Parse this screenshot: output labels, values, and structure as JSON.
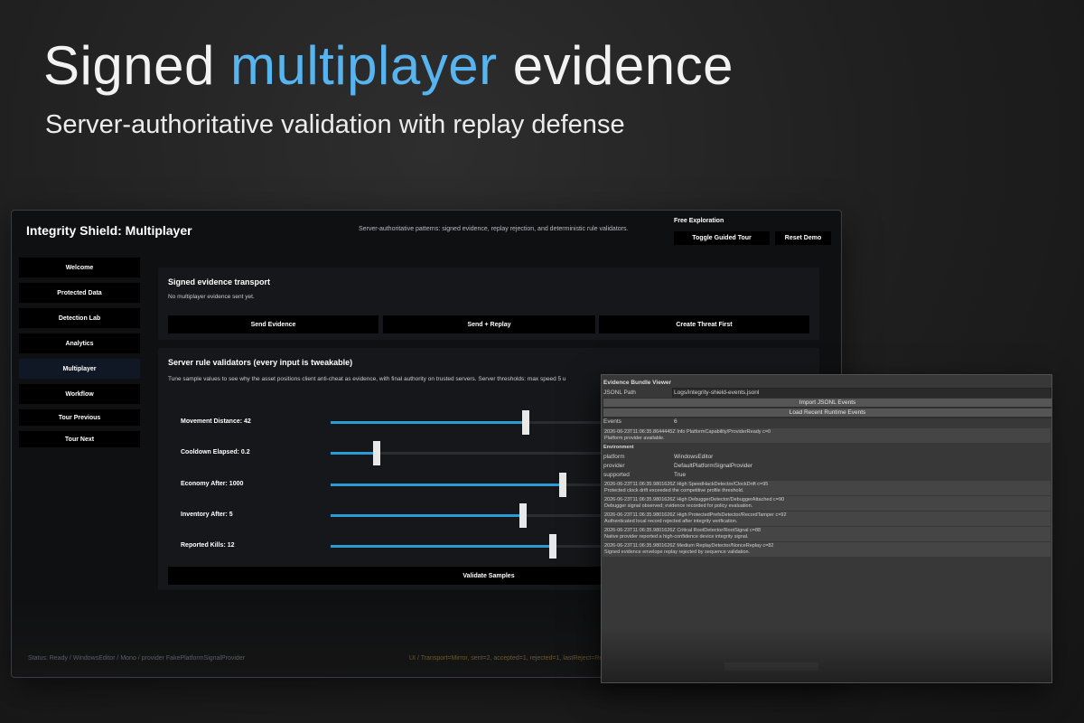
{
  "hero": {
    "title_pre": "Signed ",
    "title_accent": "multiplayer",
    "title_post": " evidence",
    "subtitle": "Server-authoritative validation with replay defense",
    "accent_color": "#58b4ee"
  },
  "app": {
    "title": "Integrity Shield: Multiplayer",
    "description": "Server-authoritative patterns: signed evidence, replay rejection, and deterministic rule validators.",
    "mode_label": "Free Exploration",
    "toggle_tour": "Toggle Guided Tour",
    "reset_demo": "Reset Demo",
    "nav": [
      {
        "label": "Welcome",
        "active": false
      },
      {
        "label": "Protected Data",
        "active": false
      },
      {
        "label": "Detection Lab",
        "active": false
      },
      {
        "label": "Analytics",
        "active": false
      },
      {
        "label": "Multiplayer",
        "active": true
      },
      {
        "label": "Workflow",
        "active": false
      },
      {
        "label": "Tour Previous",
        "active": false
      },
      {
        "label": "Tour Next",
        "active": false
      }
    ],
    "transport": {
      "title": "Signed evidence transport",
      "status": "No multiplayer evidence sent yet.",
      "buttons": [
        "Send Evidence",
        "Send + Replay",
        "Create Threat First"
      ]
    },
    "validators": {
      "title": "Server rule validators (every input is tweakable)",
      "description": "Tune sample values to see why the asset positions client anti-cheat as evidence, with final authority on trusted servers. Server thresholds: max speed 5 u",
      "sliders": [
        {
          "label": "Movement Distance: 42",
          "fraction": 0.4
        },
        {
          "label": "Cooldown Elapsed: 0.2",
          "fraction": 0.095
        },
        {
          "label": "Economy After: 1000",
          "fraction": 0.475
        },
        {
          "label": "Inventory After: 5",
          "fraction": 0.395
        },
        {
          "label": "Reported Kills: 12",
          "fraction": 0.455
        }
      ],
      "validate_button": "Validate Samples",
      "accent_color": "#2a9bd4"
    },
    "status_left": "Status: Ready / WindowsEditor / Mono / provider FakePlatformSignalProvider",
    "status_right": "UI / Transport=Mirror, sent=2, accepted=1, rejected=1, lastReject=Re"
  },
  "viewer": {
    "title": "Evidence Bundle Viewer",
    "jsonl_label": "JSONL Path",
    "jsonl_value": "Logs/integrity-shield-events.jsonl",
    "import_button": "Import JSONL Events",
    "load_button": "Load Recent Runtime Events",
    "events_label": "Events",
    "events_count": "6",
    "first_event": {
      "line1": "2026-06-23T11:06:35.8644445Z Info PlatformCapability/ProviderReady c=0",
      "line2": "Platform provider available."
    },
    "environment_label": "Environment",
    "environment": [
      {
        "key": "platform",
        "value": "WindowsEditor"
      },
      {
        "key": "provider",
        "value": "DefaultPlatformSignalProvider"
      },
      {
        "key": "supported",
        "value": "True"
      }
    ],
    "events": [
      {
        "line1": "2026-06-23T11:06:35.9801626Z High SpeedHackDetector/ClockDrift c=95",
        "line2": "Protected clock drift exceeded the competitive profile threshold."
      },
      {
        "line1": "2026-06-23T11:06:35.9801626Z High DebuggerDetector/DebuggerAttached c=90",
        "line2": "Debugger signal observed; evidence recorded for policy evaluation."
      },
      {
        "line1": "2026-06-23T11:06:35.9801626Z High ProtectedPrefsDetector/RecordTamper c=92",
        "line2": "Authenticated local record rejected after integrity verification."
      },
      {
        "line1": "2026-06-23T11:06:35.9801626Z Critical RootDetector/RootSignal c=88",
        "line2": "Native provider reported a high-confidence device integrity signal."
      },
      {
        "line1": "2026-06-23T11:06:35.9801626Z Medium ReplayDetector/NonceReplay c=82",
        "line2": "Signed evidence envelope replay rejected by sequence validation."
      }
    ]
  }
}
